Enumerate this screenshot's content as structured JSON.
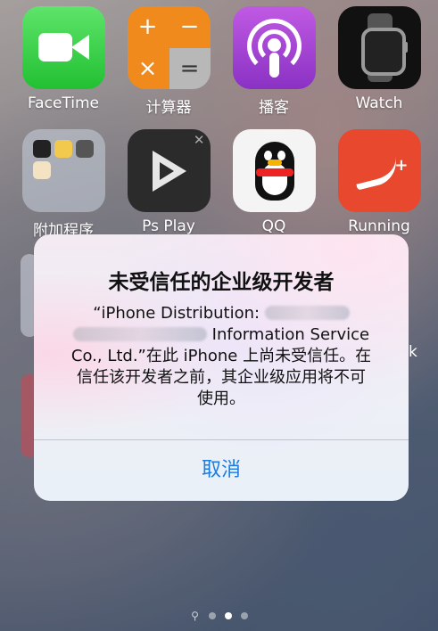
{
  "home": {
    "apps": [
      {
        "label": "FaceTime",
        "icon": "facetime-icon"
      },
      {
        "label": "计算器",
        "icon": "calculator-icon"
      },
      {
        "label": "播客",
        "icon": "podcasts-icon"
      },
      {
        "label": "Watch",
        "icon": "watch-icon"
      },
      {
        "label": "附加程序",
        "icon": "folder-icon"
      },
      {
        "label": "Ps Play",
        "icon": "ps-play-icon"
      },
      {
        "label": "QQ",
        "icon": "qq-penguin-icon"
      },
      {
        "label": "Running",
        "icon": "nike-running-icon"
      }
    ],
    "calculator_symbols": [
      "+",
      "−",
      "×",
      "="
    ],
    "partial_label": "k",
    "page_indicator": {
      "pages": 3,
      "current": 2
    }
  },
  "alert": {
    "title": "未受信任的企业级开发者",
    "message": {
      "line1": "“iPhone Distribution:",
      "line2": "Information Service",
      "line3": "Co., Ltd.”在此 iPhone 上尚未受信任。在",
      "line4": "信任该开发者之前，其企业级应用将不可",
      "line5": "使用。"
    },
    "button": "取消"
  },
  "colors": {
    "button_blue": "#1a7de0",
    "facetime_green": "#22c032",
    "calculator_orange": "#f08a1c",
    "podcasts_purple": "#8a31c4",
    "nike_red": "#e8482e"
  }
}
